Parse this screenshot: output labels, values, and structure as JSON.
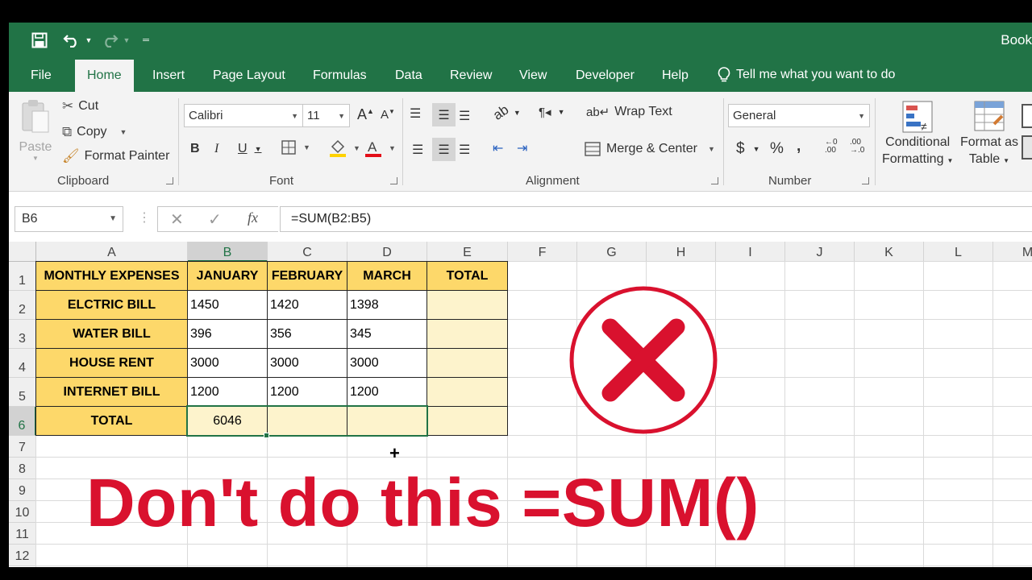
{
  "window": {
    "title": "Book"
  },
  "tabs": [
    "File",
    "Home",
    "Insert",
    "Page Layout",
    "Formulas",
    "Data",
    "Review",
    "View",
    "Developer",
    "Help"
  ],
  "active_tab": "Home",
  "tell_me": "Tell me what you want to do",
  "ribbon": {
    "clipboard": {
      "paste": "Paste",
      "cut": "Cut",
      "copy": "Copy",
      "format_painter": "Format Painter",
      "label": "Clipboard"
    },
    "font": {
      "family": "Calibri",
      "size": "11",
      "bold": "B",
      "italic": "I",
      "underline": "U",
      "label": "Font"
    },
    "alignment": {
      "wrap_text": "Wrap Text",
      "merge_center": "Merge & Center",
      "label": "Alignment"
    },
    "number": {
      "format": "General",
      "currency": "$",
      "percent": "%",
      "comma": ",",
      "label": "Number"
    },
    "styles": {
      "conditional_line1": "Conditional",
      "conditional_line2": "Formatting",
      "table_line1": "Format as",
      "table_line2": "Table"
    }
  },
  "formula_bar": {
    "name_box": "B6",
    "formula": "=SUM(B2:B5)",
    "fx": "fx"
  },
  "sheet": {
    "columns": [
      "A",
      "B",
      "C",
      "D",
      "E",
      "F",
      "G",
      "H",
      "I",
      "J",
      "K",
      "L",
      "M"
    ],
    "rows": [
      "1",
      "2",
      "3",
      "4",
      "5",
      "6",
      "7",
      "8",
      "9",
      "10",
      "11",
      "12"
    ],
    "selected_cell": "B6",
    "headers": [
      "MONTHLY EXPENSES",
      "JANUARY",
      "FEBRUARY",
      "MARCH",
      "TOTAL"
    ],
    "data_rows": [
      {
        "label": "ELCTRIC BILL",
        "values": [
          "1450",
          "1420",
          "1398"
        ]
      },
      {
        "label": "WATER BILL",
        "values": [
          "396",
          "356",
          "345"
        ]
      },
      {
        "label": "HOUSE RENT",
        "values": [
          "3000",
          "3000",
          "3000"
        ]
      },
      {
        "label": "INTERNET BILL",
        "values": [
          "1200",
          "1200",
          "1200"
        ]
      }
    ],
    "total_row": {
      "label": "TOTAL",
      "values": [
        "6046",
        "",
        ""
      ]
    }
  },
  "overlay": {
    "caption": "Don't do this =SUM()",
    "mark_color": "#d9112e",
    "mark_icon": "x-cross-icon"
  },
  "colors": {
    "excel_green": "#217346",
    "header_yellow": "#fdd86a",
    "light_yellow": "#fdf3cc"
  }
}
